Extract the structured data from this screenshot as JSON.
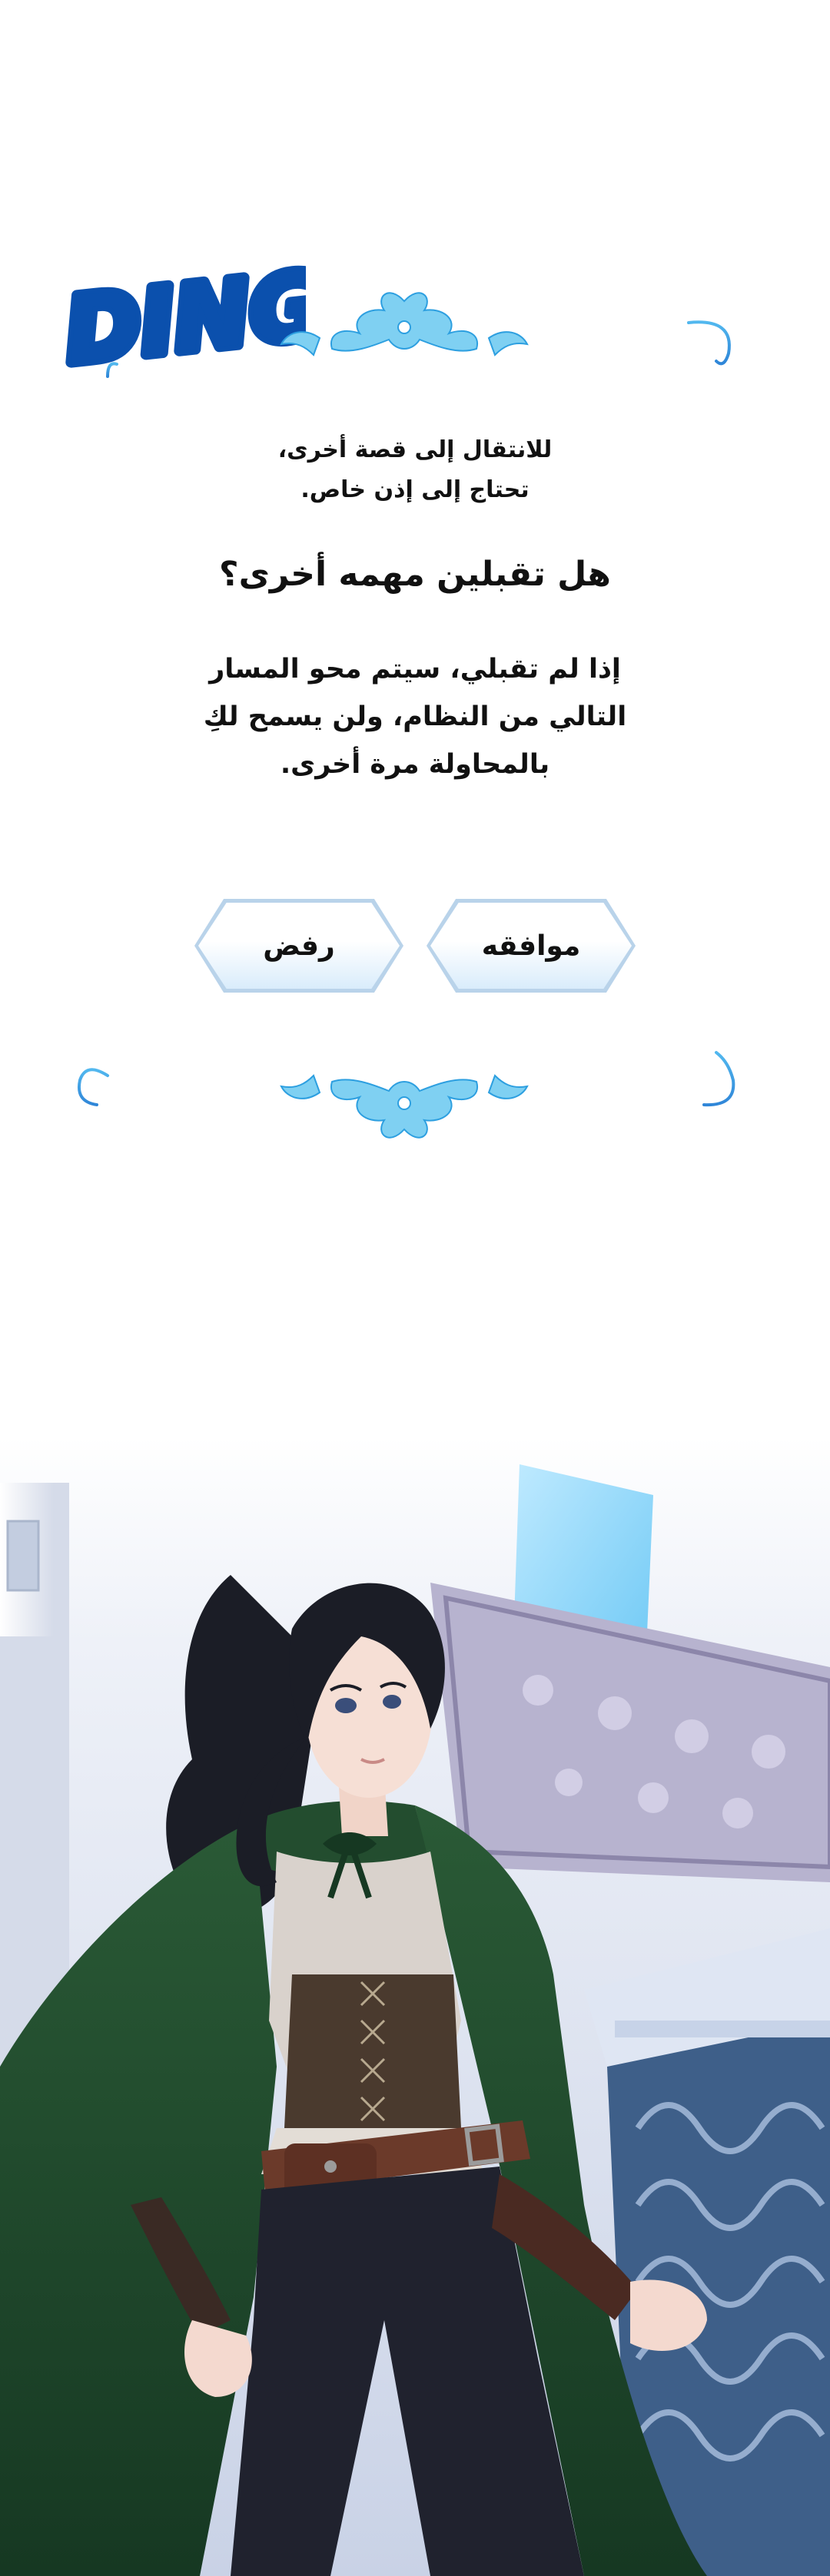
{
  "sound_effect": {
    "text": "DING",
    "color": "#0b50ad"
  },
  "system_window": {
    "intro_line_1": "للانتقال إلى قصة أخرى،",
    "intro_line_2": "تحتاج إلى إذن خاص.",
    "question": "هل تقبلين مهمه أخرى؟",
    "warning_line_1": "إذا لم تقبلي، سيتم محو المسار",
    "warning_line_2": "التالي من النظام، ولن يسمح لكِ",
    "warning_line_3": "بالمحاولة مرة أخرى.",
    "accept_label": "موافقه",
    "reject_label": "رفض",
    "frame_color": "#3fa9e6",
    "ornament_color": "#5fc0ec"
  },
  "illustration": {
    "subject": "woman-in-green-cloak",
    "cloak_color": "#1f4a2c",
    "hair_color": "#1b1d26",
    "shirt_color": "#d9d2cc",
    "corset_color": "#4a3a2e",
    "pants_color": "#20222e",
    "belt_color": "#6b3a2a",
    "background_color": "#e8ecf6"
  }
}
